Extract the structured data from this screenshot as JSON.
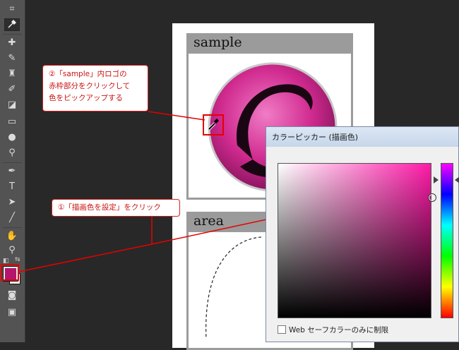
{
  "document": {
    "panels": [
      {
        "title": "sample"
      },
      {
        "title": "area"
      }
    ]
  },
  "callouts": {
    "step2_lines": [
      "②「sample」内ロゴの",
      "赤枠部分をクリックして",
      "色をピックアップする"
    ],
    "step1": "①「描画色を設定」をクリック"
  },
  "color_picker": {
    "title": "カラーピッカー (描画色)",
    "websafe_label": "Web セーフカラーのみに制限",
    "websafe_checked": false
  },
  "toolbar": {
    "foreground_color": "#b4166e",
    "background_color": "#ffffff",
    "tools": [
      "crop-icon",
      "eyedropper-icon",
      "healing-brush-icon",
      "brush-icon",
      "clone-stamp-icon",
      "history-brush-icon",
      "eraser-icon",
      "gradient-icon",
      "blur-icon",
      "dodge-icon",
      "pen-icon",
      "type-icon",
      "path-selection-icon",
      "line-icon",
      "hand-icon",
      "zoom-icon"
    ]
  },
  "colors": {
    "annotation_red": "#e60000",
    "logo_magenta": "#d02a8f"
  }
}
